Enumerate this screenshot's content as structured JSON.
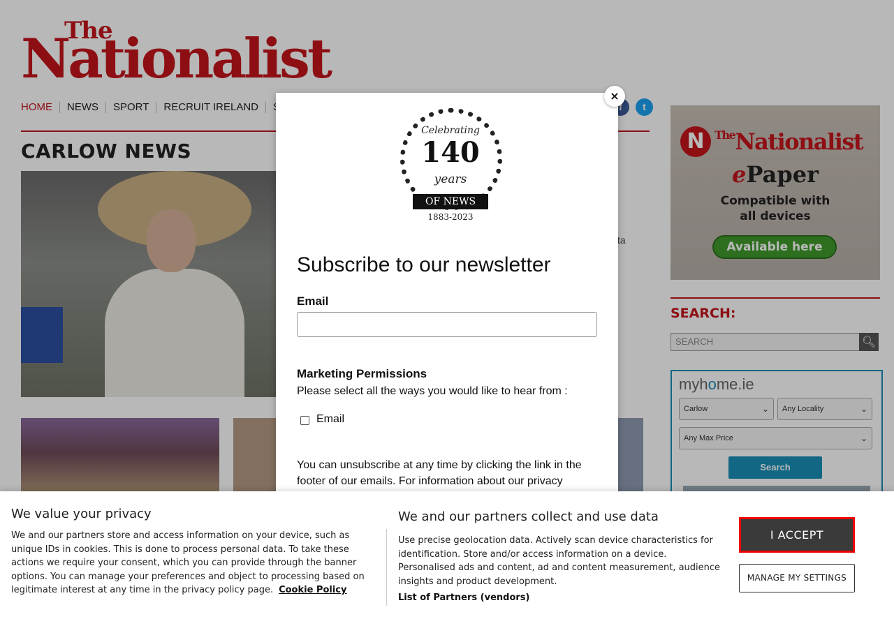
{
  "header": {
    "logo_top": "The",
    "logo_main": "Nationalist"
  },
  "nav": {
    "items": [
      "HOME",
      "NEWS",
      "SPORT",
      "RECRUIT IRELAND",
      "SP"
    ]
  },
  "social": {
    "facebook": "f",
    "twitter": "t"
  },
  "section": {
    "title": "CARLOW NEWS",
    "teaser_fragment": "ta"
  },
  "ad": {
    "logo_letter": "N",
    "brand": "Nationalist",
    "brand_prefix": "The",
    "epaper_e": "e",
    "epaper_rest": "Paper",
    "compat_line1": "Compatible with",
    "compat_line2": "all devices",
    "button": "Available here"
  },
  "search": {
    "title": "SEARCH:",
    "placeholder": "SEARCH",
    "button_icon": "magnifier-icon"
  },
  "myhome": {
    "logo_a": "myh",
    "logo_o": "o",
    "logo_b": "me.ie",
    "county": "Carlow",
    "locality": "Any Locality",
    "max_price": "Any Max Price",
    "search_button": "Search"
  },
  "modal": {
    "close": "×",
    "badge": {
      "celebrating": "Celebrating",
      "number": "140",
      "years": "years",
      "banner": "OF NEWS",
      "dates": "1883-2023"
    },
    "title": "Subscribe to our newsletter",
    "email_label": "Email",
    "marketing_title": "Marketing Permissions",
    "marketing_prompt": "Please select all the ways you would like to hear from :",
    "checkbox_label": "Email",
    "unsubscribe_text": "You can unsubscribe at any time by clicking the link in the footer of our emails. For information about our privacy"
  },
  "cookie": {
    "title": "We value your privacy",
    "body": "We and our partners store and access information on your device, such as unique IDs in cookies. This is done to process personal data. To take these actions we require your consent, which you can provide through the banner options. You can manage your preferences and object to processing based on legitimate interest at any time in the privacy policy page.",
    "cookie_policy_link": "Cookie Policy",
    "title2": "We and our partners collect and use data",
    "body2": "Use precise geolocation data. Actively scan device characteristics for identification. Store and/or access information on a device. Personalised ads and content, ad and content measurement, audience insights and product development.",
    "partners_link": "List of Partners (vendors)",
    "accept_button": "I ACCEPT",
    "manage_button": "MANAGE MY SETTINGS"
  },
  "colors": {
    "brand_red": "#c4161c",
    "accept_border": "#ee0000",
    "myhome_blue": "#1a8fb8"
  }
}
